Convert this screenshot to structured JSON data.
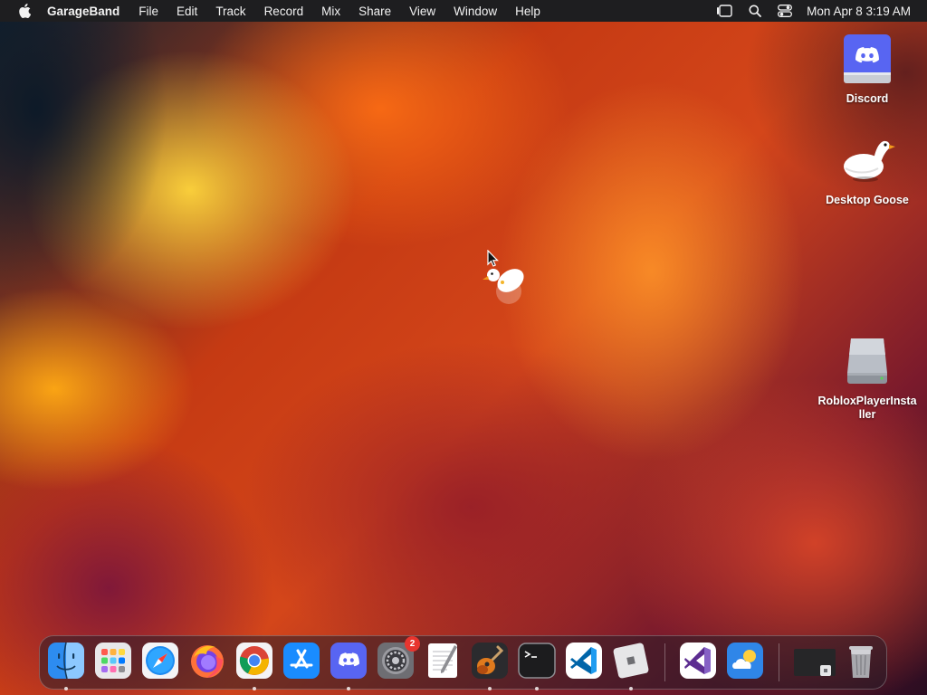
{
  "menubar": {
    "app_name": "GarageBand",
    "menus": [
      "File",
      "Edit",
      "Track",
      "Record",
      "Mix",
      "Share",
      "View",
      "Window",
      "Help"
    ],
    "clock": "Mon Apr 8  3:19 AM"
  },
  "desktop": {
    "icons": [
      {
        "label": "Discord",
        "icon": "discord-drive-icon"
      },
      {
        "label": "Desktop Goose",
        "icon": "goose-icon"
      },
      {
        "label": "RobloxPlayerInstaller",
        "icon": "disk-image-icon"
      }
    ]
  },
  "dock": {
    "apps": [
      {
        "name": "Finder",
        "running": true
      },
      {
        "name": "Launchpad",
        "running": false
      },
      {
        "name": "Safari",
        "running": false
      },
      {
        "name": "Firefox",
        "running": false
      },
      {
        "name": "Google Chrome",
        "running": true
      },
      {
        "name": "App Store",
        "running": false
      },
      {
        "name": "Discord",
        "running": true
      },
      {
        "name": "System Settings",
        "running": false,
        "badge": "2"
      },
      {
        "name": "TextEdit",
        "running": false
      },
      {
        "name": "GarageBand",
        "running": true
      },
      {
        "name": "Terminal",
        "running": true
      },
      {
        "name": "Visual Studio Code",
        "running": false
      },
      {
        "name": "Roblox",
        "running": true
      },
      {
        "name": "Visual Studio",
        "running": false
      },
      {
        "name": "Weather",
        "running": false
      },
      {
        "name": "Recent Window",
        "running": false
      },
      {
        "name": "Trash",
        "running": false
      }
    ]
  },
  "colors": {
    "menubar_bg": "#1e1e20",
    "badge_red": "#e8352e",
    "discord_blurple": "#5865f2"
  }
}
